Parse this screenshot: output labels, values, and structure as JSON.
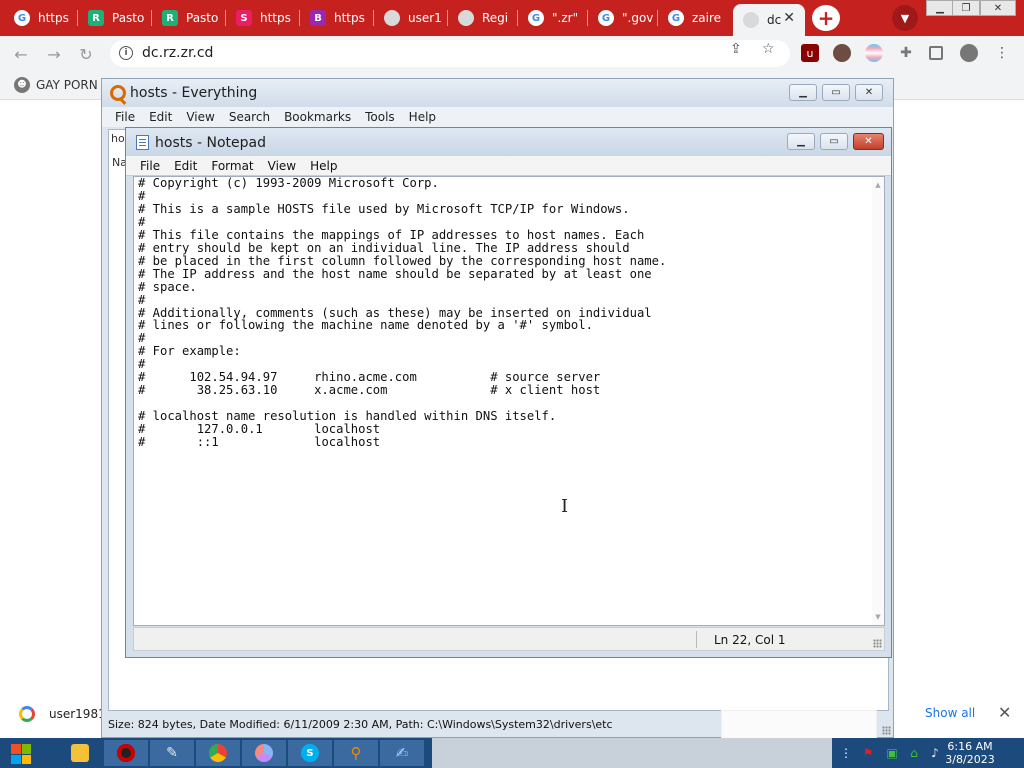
{
  "browser": {
    "tabs": [
      {
        "label": "https",
        "icon": "google"
      },
      {
        "label": "Pasto",
        "icon": "r-app"
      },
      {
        "label": "Pasto",
        "icon": "r-app"
      },
      {
        "label": "https",
        "icon": "s-app"
      },
      {
        "label": "https",
        "icon": "b-app"
      },
      {
        "label": "user1",
        "icon": "globe"
      },
      {
        "label": "Regi",
        "icon": "globe"
      },
      {
        "label": "\".zr\"",
        "icon": "google"
      },
      {
        "label": "\".gov",
        "icon": "google"
      },
      {
        "label": "zaire",
        "icon": "google"
      },
      {
        "label": "dc",
        "icon": "globe"
      }
    ],
    "url": "dc.rz.zr.cd",
    "bookmark": "GAY PORN",
    "colors": {
      "tabstrip": "#c5221f",
      "toolbar": "#f1f3f4"
    }
  },
  "everything": {
    "title": "hosts - Everything",
    "menu": [
      "File",
      "Edit",
      "View",
      "Search",
      "Bookmarks",
      "Tools",
      "Help"
    ],
    "search_fragment": "ho",
    "column_fragment": "Na",
    "status": "Size: 824 bytes, Date Modified: 6/11/2009 2:30 AM, Path: C:\\Windows\\System32\\drivers\\etc"
  },
  "notepad": {
    "title": "hosts - Notepad",
    "menu": [
      "File",
      "Edit",
      "Format",
      "View",
      "Help"
    ],
    "content": "# Copyright (c) 1993-2009 Microsoft Corp.\n#\n# This is a sample HOSTS file used by Microsoft TCP/IP for Windows.\n#\n# This file contains the mappings of IP addresses to host names. Each\n# entry should be kept on an individual line. The IP address should\n# be placed in the first column followed by the corresponding host name.\n# The IP address and the host name should be separated by at least one\n# space.\n#\n# Additionally, comments (such as these) may be inserted on individual\n# lines or following the machine name denoted by a '#' symbol.\n#\n# For example:\n#\n#      102.54.94.97     rhino.acme.com          # source server\n#       38.25.63.10     x.acme.com              # x client host\n\n# localhost name resolution is handled within DNS itself.\n#\t127.0.0.1       localhost\n#\t::1             localhost",
    "status_position": "Ln 22, Col 1"
  },
  "downloads": {
    "item": "user1981",
    "show_all": "Show all"
  },
  "taskbar": {
    "time": "6:16 AM",
    "date": "3/8/2023"
  }
}
